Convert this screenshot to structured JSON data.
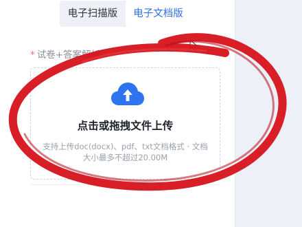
{
  "tabs": [
    {
      "label": "电子扫描版",
      "active": false
    },
    {
      "label": "电子文档版",
      "active": true
    }
  ],
  "field": {
    "required_mark": "*",
    "label": "试卷+答案解析"
  },
  "upload": {
    "icon": "cloud-upload-icon",
    "title": "点击或拖拽文件上传",
    "hint_line1": "支持上传doc(docx)、pdf、txt文档格式 · 文档",
    "hint_line2": "大小最多不超过20.00M"
  },
  "colors": {
    "accent": "#2f6ff0",
    "cloud": "#2e73f0",
    "annotation": "#d6121b",
    "required": "#f56c6c"
  }
}
